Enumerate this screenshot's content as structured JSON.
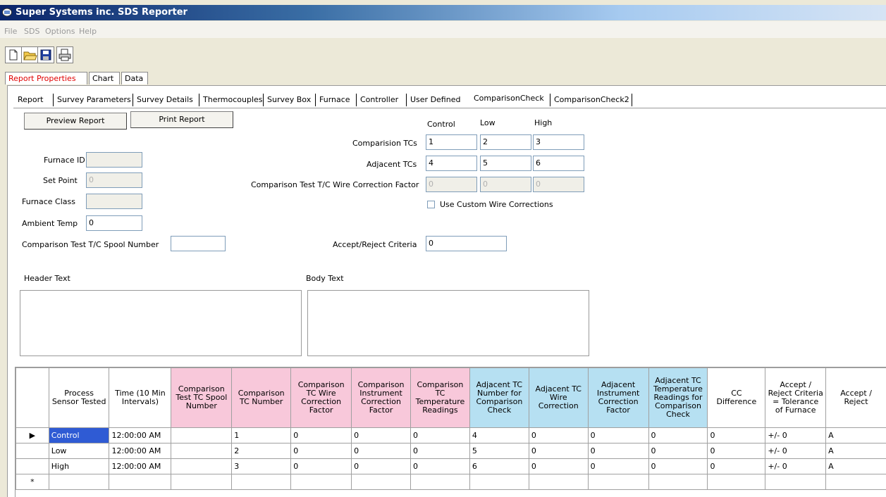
{
  "window": {
    "title": "Super Systems inc. SDS Reporter"
  },
  "menu": [
    "File",
    "SDS",
    "Options",
    "Help"
  ],
  "toolbar": {
    "icons": [
      "new-document-icon",
      "open-folder-icon",
      "save-disk-icon",
      "print-icon"
    ]
  },
  "main_tabs": [
    {
      "label": "Report Properties",
      "active": true
    },
    {
      "label": "Chart",
      "active": false
    },
    {
      "label": "Data",
      "active": false
    }
  ],
  "sub_tabs": [
    "Report",
    "Survey Parameters",
    "Survey Details",
    "Thermocouples",
    "Survey Box",
    "Furnace",
    "Controller",
    "User Defined",
    "ComparisonCheck",
    "ComparisonCheck2"
  ],
  "buttons": {
    "preview": "Preview Report",
    "print": "Print Report"
  },
  "form": {
    "furnace_id_label": "Furnace ID",
    "furnace_id": "",
    "set_point_label": "Set Point",
    "set_point": "0",
    "furnace_class_label": "Furnace Class",
    "furnace_class": "",
    "ambient_temp_label": "Ambient Temp",
    "ambient_temp": "0",
    "spool_label": "Comparison Test T/C Spool Number",
    "spool": "",
    "col_control": "Control",
    "col_low": "Low",
    "col_high": "High",
    "comparison_tcs_label": "Comparision TCs",
    "comparison_tcs": [
      "1",
      "2",
      "3"
    ],
    "adjacent_tcs_label": "Adjacent TCs",
    "adjacent_tcs": [
      "4",
      "5",
      "6"
    ],
    "wire_correction_label": "Comparison Test T/C Wire Correction Factor",
    "wire_correction": [
      "0",
      "0",
      "0"
    ],
    "custom_wire_label": "Use Custom Wire Corrections",
    "accept_reject_label": "Accept/Reject Criteria",
    "accept_reject": "0",
    "header_text_label": "Header Text",
    "body_text_label": "Body Text"
  },
  "grid": {
    "headers": [
      "Process Sensor Tested",
      "Time (10 Min Intervals)",
      "Comparison Test TC Spool Number",
      "Comparison TC Number",
      "Comparison TC Wire Correction Factor",
      "Comparison Instrument Correction Factor",
      "Comparison TC Temperature Readings",
      "Adjacent TC Number for Comparison Check",
      "Adjacent TC Wire Correction",
      "Adjacent Instrument Correction Factor",
      "Adjacent TC Temperature Readings for Comparison Check",
      "CC Difference",
      "Accept / Reject Criteria = Tolerance of Furnace",
      "Accept / Reject"
    ],
    "rows": [
      [
        "Control",
        "12:00:00 AM",
        "",
        "1",
        "0",
        "0",
        "0",
        "4",
        "0",
        "0",
        "0",
        "0",
        "+/- 0",
        "A"
      ],
      [
        "Low",
        "12:00:00 AM",
        "",
        "2",
        "0",
        "0",
        "0",
        "5",
        "0",
        "0",
        "0",
        "0",
        "+/- 0",
        "A"
      ],
      [
        "High",
        "12:00:00 AM",
        "",
        "3",
        "0",
        "0",
        "0",
        "6",
        "0",
        "0",
        "0",
        "0",
        "+/- 0",
        "A"
      ]
    ],
    "current_row_marker": "▶",
    "new_row_marker": "*"
  }
}
